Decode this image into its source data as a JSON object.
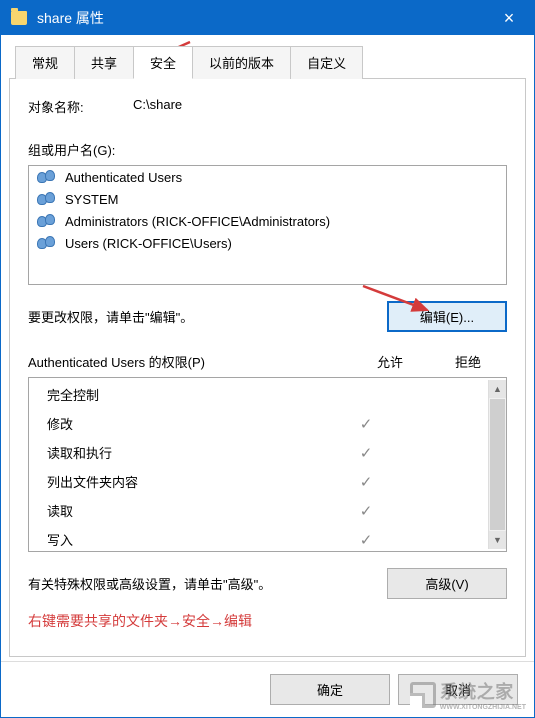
{
  "window": {
    "title": "share 属性",
    "close_glyph": "×"
  },
  "tabs": [
    "常规",
    "共享",
    "安全",
    "以前的版本",
    "自定义"
  ],
  "active_tab_index": 2,
  "object": {
    "label": "对象名称:",
    "value": "C:\\share"
  },
  "groups_label": "组或用户名(G):",
  "groups": [
    "Authenticated Users",
    "SYSTEM",
    "Administrators (RICK-OFFICE\\Administrators)",
    "Users (RICK-OFFICE\\Users)"
  ],
  "edit_hint": "要更改权限，请单击\"编辑\"。",
  "edit_button": "编辑(E)...",
  "perm_title": "Authenticated Users 的权限(P)",
  "perm_cols": {
    "allow": "允许",
    "deny": "拒绝"
  },
  "permissions": [
    {
      "name": "完全控制",
      "allow": false,
      "deny": false
    },
    {
      "name": "修改",
      "allow": true,
      "deny": false
    },
    {
      "name": "读取和执行",
      "allow": true,
      "deny": false
    },
    {
      "name": "列出文件夹内容",
      "allow": true,
      "deny": false
    },
    {
      "name": "读取",
      "allow": true,
      "deny": false
    },
    {
      "name": "写入",
      "allow": true,
      "deny": false
    }
  ],
  "check_glyph": "✓",
  "advanced_hint": "有关特殊权限或高级设置，请单击\"高级\"。",
  "advanced_button": "高级(V)",
  "annotation": "右键需要共享的文件夹→安全→编辑",
  "bottom_buttons": {
    "ok": "确定",
    "cancel": "取消"
  },
  "watermark": {
    "line1": "系统之家",
    "line2": "WWW.XITONGZHIJIA.NET"
  },
  "scroll": {
    "up": "▲",
    "down": "▼"
  }
}
